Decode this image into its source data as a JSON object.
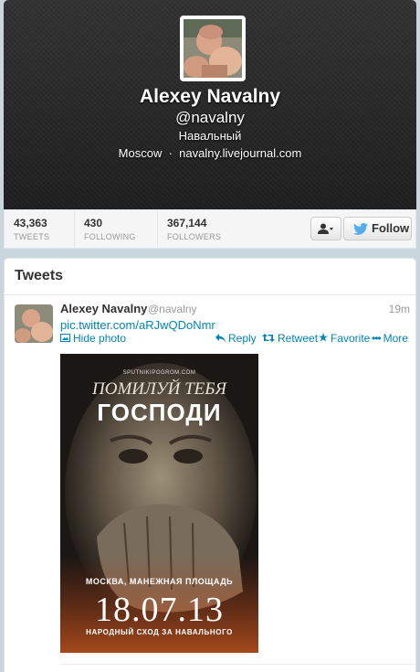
{
  "profile": {
    "name": "Alexey Navalny",
    "handle": "@navalny",
    "bio": "Навальный",
    "location": "Moscow",
    "separator": "·",
    "website": "navalny.livejournal.com"
  },
  "stats": [
    {
      "value": "43,363",
      "label": "TWEETS"
    },
    {
      "value": "430",
      "label": "FOLLOWING"
    },
    {
      "value": "367,144",
      "label": "FOLLOWERS"
    }
  ],
  "actions": {
    "user_menu_icon": "person-icon",
    "follow_label": "Follow"
  },
  "tweets_section": {
    "title": "Tweets"
  },
  "tweet": {
    "name": "Alexey Navalny",
    "handle": "@navalny",
    "time": "19m",
    "link": "pic.twitter.com/aRJwQDoNmr",
    "hide_photo": "Hide photo",
    "reply": "Reply",
    "retweet": "Retweet",
    "favorite": "Favorite",
    "more": "More"
  },
  "poster": {
    "site": "SPUTNIKIPOGROM.COM",
    "line1": "ПОМИЛУЙ ТЕБЯ",
    "line2": "ГОСПОДИ",
    "place": "МОСКВА, МАНЕЖНАЯ ПЛОЩАДЬ",
    "date": "18.07.13",
    "sub": "НАРОДНЫЙ СХОД ЗА НАВАЛЬНОГО"
  },
  "colors": {
    "link": "#0084b4",
    "header_bg": "#2a2a2a",
    "page_bg": "#c9d6de",
    "twitter_blue": "#55acee"
  }
}
